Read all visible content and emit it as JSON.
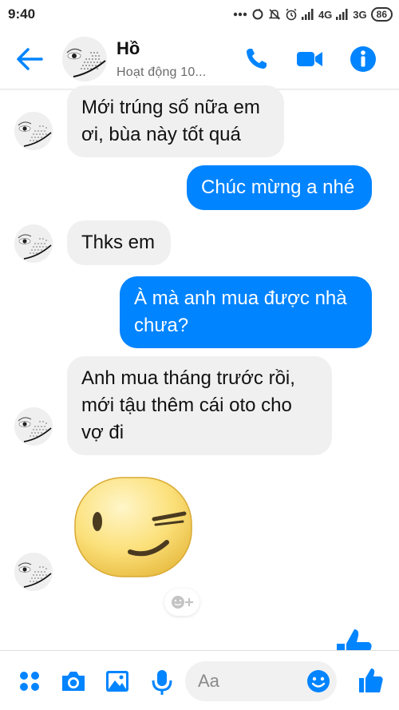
{
  "status_bar": {
    "time": "9:40",
    "network_1": "4G",
    "network_2": "3G",
    "battery": "86"
  },
  "header": {
    "contact_name": "Hồ",
    "contact_status": "Hoạt động 10...",
    "accent_color": "#0084ff"
  },
  "messages": [
    {
      "direction": "incoming",
      "text": "Mới trúng số nữa em ơi, bùa này tốt quá"
    },
    {
      "direction": "outgoing",
      "text": "Chúc mừng a nhé"
    },
    {
      "direction": "incoming",
      "text": "Thks em"
    },
    {
      "direction": "outgoing",
      "text": "À mà anh mua được nhà chưa?"
    },
    {
      "direction": "incoming",
      "text": "Anh mua tháng trước rồi, mới tậu thêm cái oto cho vợ đi"
    },
    {
      "direction": "incoming",
      "type": "sticker",
      "sticker": "winking-face"
    }
  ],
  "composer": {
    "placeholder": "Aa"
  },
  "icons": {
    "back": "back-arrow-icon",
    "call": "phone-icon",
    "video": "video-camera-icon",
    "info": "info-icon",
    "menu": "grid-dots-icon",
    "camera": "camera-icon",
    "gallery": "image-icon",
    "mic": "microphone-icon",
    "emoji": "smiley-icon",
    "like": "thumbs-up-icon"
  }
}
